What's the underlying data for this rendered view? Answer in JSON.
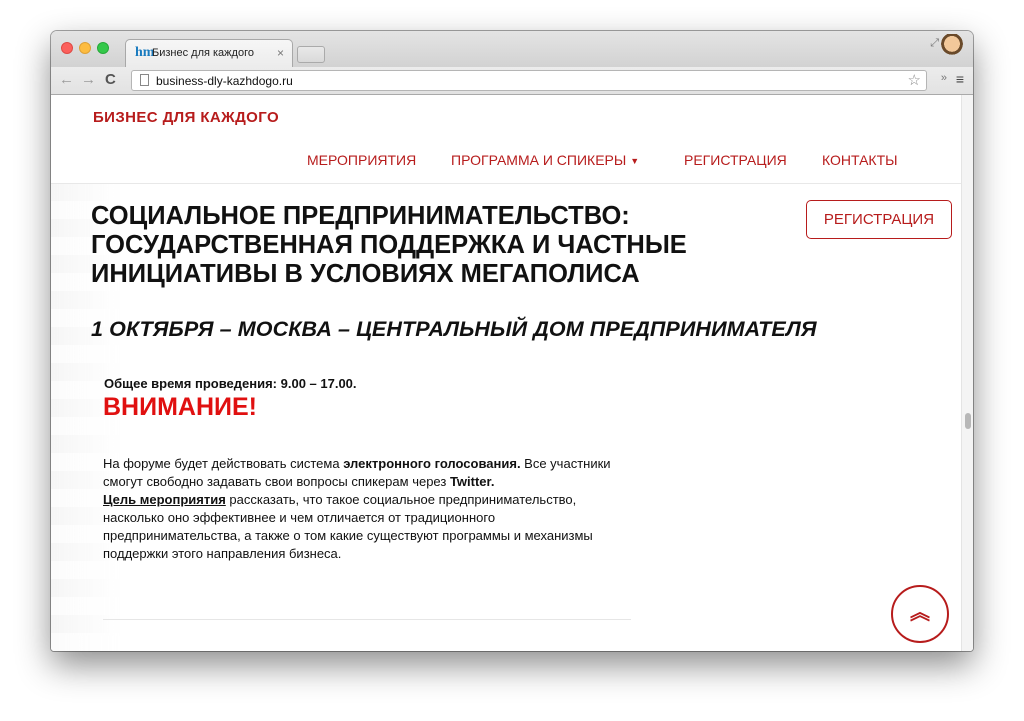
{
  "browser": {
    "tab_title": "Бизнес для каждого",
    "tab_favicon": "hm",
    "tab_close": "×",
    "url": "business-dly-kazhdogo.ru",
    "back": "←",
    "forward": "→",
    "reload": "C",
    "star": "☆",
    "extensions": "»",
    "menu": "≡",
    "fullscreen": "⤢"
  },
  "site": {
    "brand": "БИЗНЕС ДЛЯ КАЖДОГО",
    "nav": [
      "МЕРОПРИЯТИЯ",
      "ПРОГРАММА И СПИКЕРЫ",
      "РЕГИСТРАЦИЯ",
      "КОНТАКТЫ"
    ],
    "nav_caret": "▼"
  },
  "hero": {
    "title_lines": [
      "СОЦИАЛЬНОЕ ПРЕДПРИНИМАТЕЛЬСТВО:",
      "ГОСУДАРСТВЕННАЯ ПОДДЕРЖКА И ЧАСТНЫЕ",
      "ИНИЦИАТИВЫ В УСЛОВИЯХ МЕГАПОЛИСА"
    ],
    "register_label": "РЕГИСТРАЦИЯ",
    "event_line": "1 ОКТЯБРЯ  – МОСКВА  – ЦЕНТРАЛЬНЫЙ ДОМ ПРЕДПРИНИМАТЕЛЯ"
  },
  "info": {
    "duration": "Общее время проведения: 9.00 – 17.00.",
    "attention": "ВНИМАНИЕ!",
    "desc_1": "На форуме будет действовать система ",
    "desc_1_bold": "электронного голосования.",
    "desc_2": " Все участники смогут свободно задавать свои вопросы спикерам через ",
    "desc_2_bold": "Twitter.",
    "goal_label": "Цель мероприятия",
    "desc_3": " рассказать, что такое социальное предпринимательство, насколько оно эффективнее и чем отличается от традиционного предпринимательства, а также о том какие существуют программы и механизмы поддержки этого направления бизнеса."
  },
  "scroll_top_icon": "︽",
  "colors": {
    "accent": "#b71c1c",
    "attention": "#e01010",
    "text": "#111111"
  }
}
